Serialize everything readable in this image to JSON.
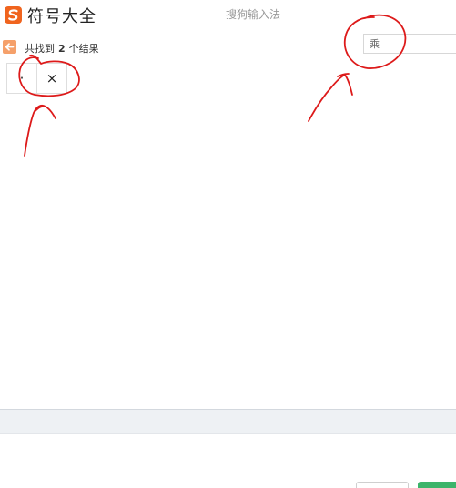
{
  "app": {
    "title": "符号大全",
    "subtitle": "搜狗输入法",
    "logo_icon": "sogou-s-logo-icon",
    "logo_color": "#f0641e"
  },
  "results": {
    "back_icon": "back-arrow-icon",
    "back_color": "#f5a06a",
    "prefix": "共找到",
    "count": "2",
    "suffix": "个结果"
  },
  "search": {
    "value": "乘",
    "placeholder": ""
  },
  "symbols": [
    "·",
    "×"
  ],
  "annotation_color": "#dd1a1a",
  "footer": {
    "confirm_color": "#3cb46a"
  }
}
